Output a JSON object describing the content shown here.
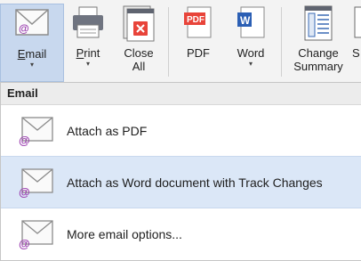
{
  "ribbon": {
    "buttons": [
      {
        "id": "email",
        "label": "Email",
        "underline": "E",
        "rest": "mail",
        "has_caret": true,
        "caret": "▾",
        "icon": "envelope-icon",
        "active": true
      },
      {
        "id": "print",
        "label": "Print",
        "underline": "P",
        "rest": "rint",
        "has_caret": true,
        "caret": "▾",
        "icon": "printer-icon"
      },
      {
        "id": "close-all",
        "label": "Close\nAll",
        "icon": "close-all-icon"
      },
      {
        "id": "pdf",
        "label": "PDF",
        "icon": "pdf-icon",
        "icon_text": "PDF"
      },
      {
        "id": "word",
        "label": "Word",
        "has_caret": true,
        "caret": "▾",
        "icon": "word-icon",
        "icon_text": "W"
      },
      {
        "id": "change-summary",
        "label": "Change\nSummary",
        "icon": "change-summary-icon"
      },
      {
        "id": "partial",
        "label": "S",
        "icon": "partial-icon"
      }
    ]
  },
  "menu": {
    "header": "Email",
    "items": [
      {
        "label": "Attach as PDF",
        "icon": "envelope-icon",
        "highlighted": false
      },
      {
        "label": "Attach as Word document with Track Changes",
        "icon": "envelope-icon",
        "highlighted": true
      },
      {
        "label": "More email options...",
        "icon": "envelope-icon",
        "highlighted": false
      }
    ]
  },
  "colors": {
    "ribbon_bg": "#f3f3f3",
    "active_bg": "#c8d8ee",
    "highlight_bg": "#dbe7f7",
    "pdf_red": "#e8443a",
    "word_blue": "#2b5fb4",
    "at_purple": "#9b3fb0"
  }
}
